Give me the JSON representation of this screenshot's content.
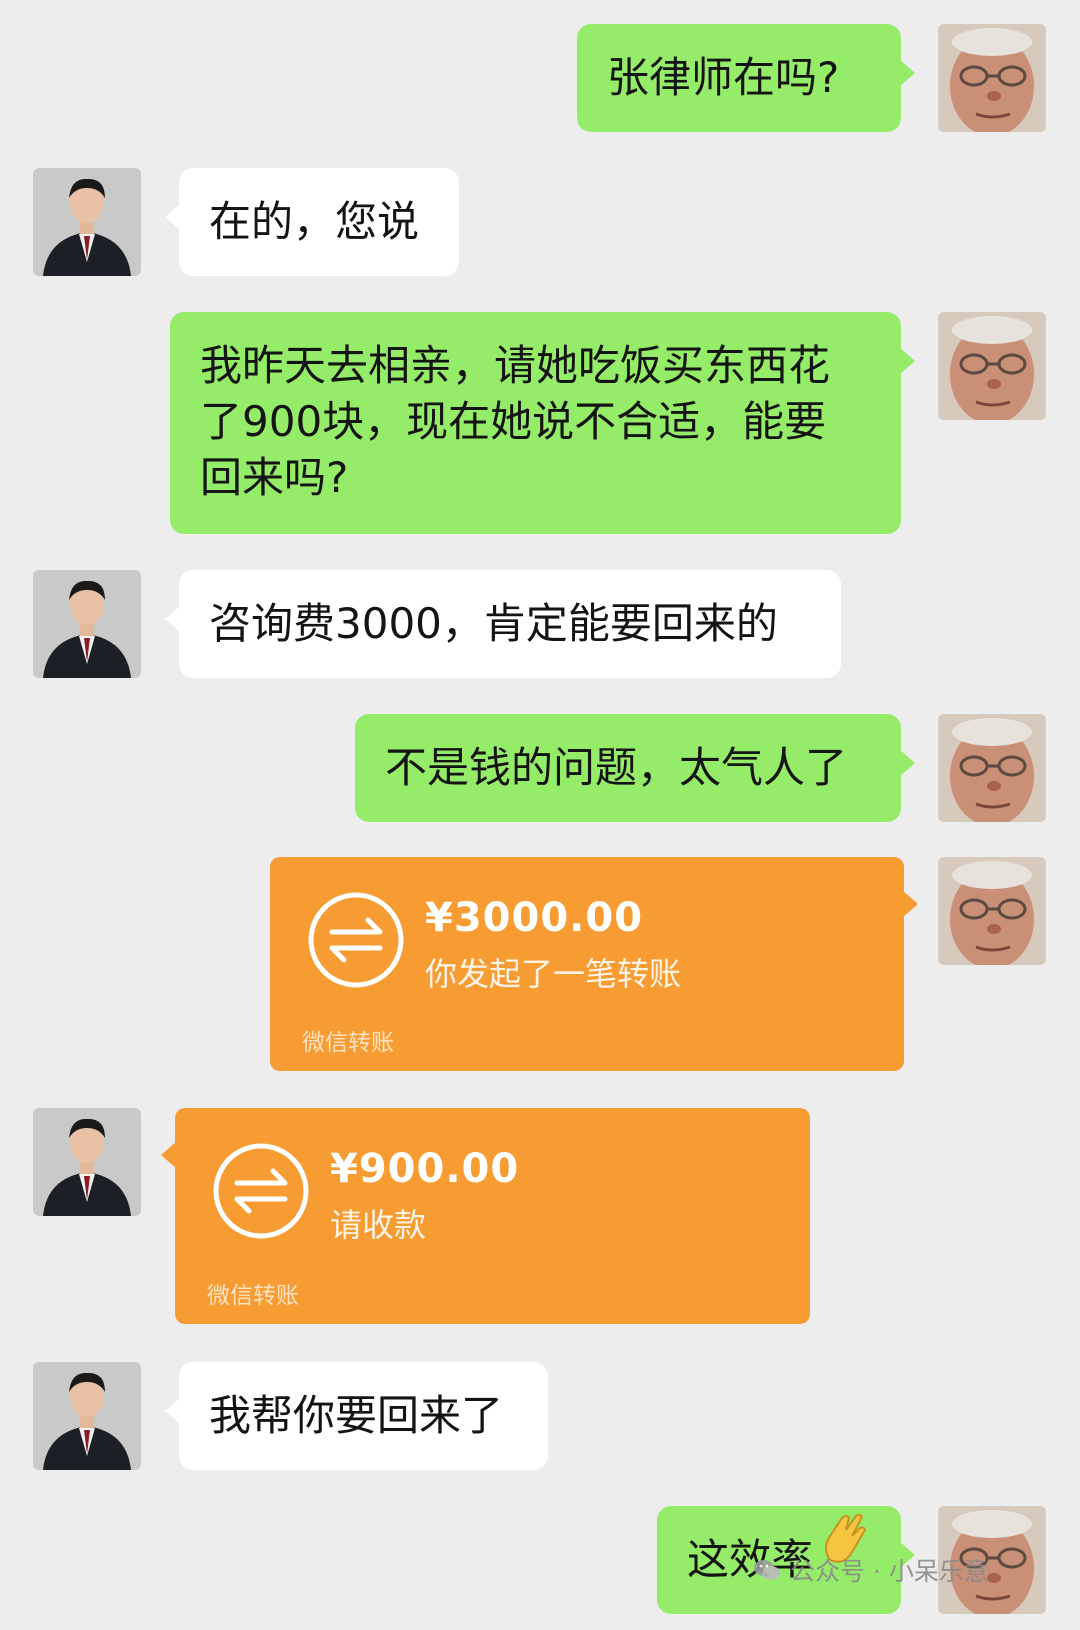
{
  "colors": {
    "background": "#ededed",
    "sent_bubble": "#95ec69",
    "received_bubble": "#ffffff",
    "transfer_card": "#f79c32"
  },
  "messages": {
    "m1": {
      "sender": "user",
      "lines": [
        "张律师在吗?"
      ]
    },
    "m2": {
      "sender": "lawyer",
      "lines": [
        "在的，您说"
      ]
    },
    "m3": {
      "sender": "user",
      "lines": [
        "我昨天去相亲，请她吃饭买东西花",
        "了900块，现在她说不合适，能要",
        "回来吗?"
      ]
    },
    "m4": {
      "sender": "lawyer",
      "lines": [
        "咨询费3000，肯定能要回来的"
      ]
    },
    "m5": {
      "sender": "user",
      "lines": [
        "不是钱的问题，太气人了"
      ]
    },
    "m6": {
      "sender": "user",
      "type": "transfer",
      "icon": "transfer-arrows-icon",
      "amount": "¥3000.00",
      "desc": "你发起了一笔转账",
      "footer": "微信转账"
    },
    "m7": {
      "sender": "lawyer",
      "type": "transfer",
      "icon": "transfer-arrows-icon",
      "amount": "¥900.00",
      "desc": "请收款",
      "footer": "微信转账"
    },
    "m8": {
      "sender": "lawyer",
      "lines": [
        "我帮你要回来了"
      ]
    },
    "m9": {
      "sender": "user",
      "lines": [
        "这效率"
      ],
      "emoji": "clap-hands-icon"
    }
  },
  "watermark": {
    "text": "公众号 · 小呆乐意",
    "icon": "wechat-icon"
  }
}
